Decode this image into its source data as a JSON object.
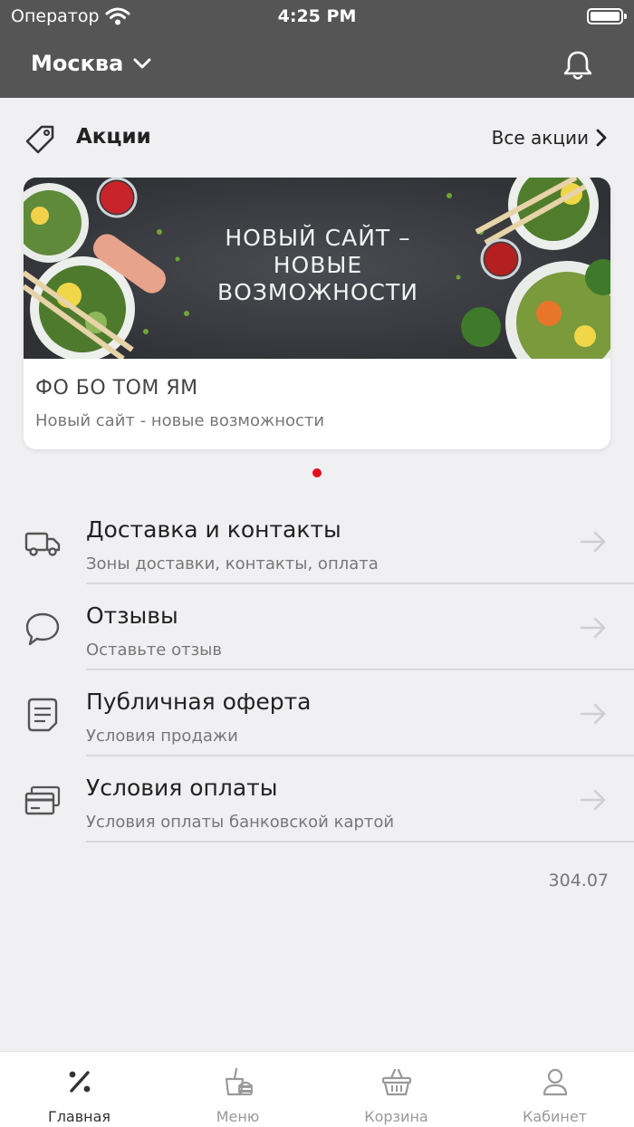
{
  "status_bar": {
    "carrier": "Оператор",
    "time": "4:25 PM"
  },
  "header": {
    "city": "Москва"
  },
  "promos": {
    "title": "Акции",
    "all_link": "Все акции",
    "card": {
      "banner_text": "НОВЫЙ САЙТ –\nНОВЫЕ\nВОЗМОЖНОСТИ",
      "name": "ФО БО ТОМ ЯМ",
      "subtitle": "Новый сайт - новые возможности"
    }
  },
  "menu": [
    {
      "icon": "truck-icon",
      "title": "Доставка и контакты",
      "subtitle": "Зоны доставки, контакты, оплата"
    },
    {
      "icon": "speech-bubble-icon",
      "title": "Отзывы",
      "subtitle": "Оставьте отзыв"
    },
    {
      "icon": "document-icon",
      "title": "Публичная оферта",
      "subtitle": "Условия продажи"
    },
    {
      "icon": "credit-card-icon",
      "title": "Условия оплаты",
      "subtitle": "Условия оплаты банковской картой"
    }
  ],
  "version": "304.07",
  "tabs": [
    {
      "icon": "percent-icon",
      "label": "Главная",
      "active": true
    },
    {
      "icon": "menu-food-icon",
      "label": "Меню",
      "active": false
    },
    {
      "icon": "basket-icon",
      "label": "Корзина",
      "active": false
    },
    {
      "icon": "user-icon",
      "label": "Кабинет",
      "active": false
    }
  ],
  "colors": {
    "header_bg": "#555555",
    "accent_dot": "#e0101e",
    "page_bg": "#f0f0f2"
  }
}
